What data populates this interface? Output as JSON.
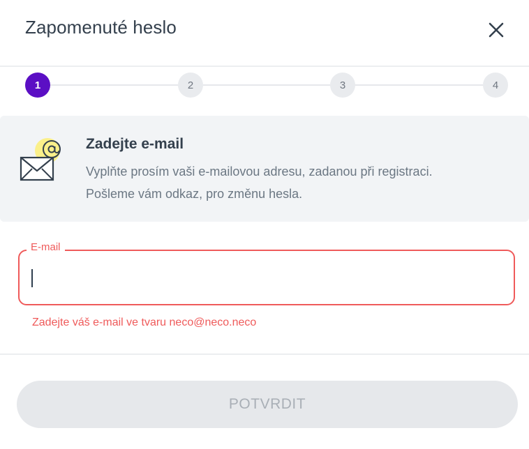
{
  "dialog": {
    "title": "Zapomenuté heslo",
    "close_icon": "close-icon"
  },
  "stepper": {
    "steps": [
      {
        "label": "1",
        "active": true
      },
      {
        "label": "2",
        "active": false
      },
      {
        "label": "3",
        "active": false
      },
      {
        "label": "4",
        "active": false
      }
    ]
  },
  "info": {
    "icon": "email-envelope-icon",
    "title": "Zadejte e-mail",
    "text_line1": "Vyplňte prosím vaši e-mailovou adresu, zadanou při registraci.",
    "text_line2": "Pošleme vám odkaz, pro změnu hesla."
  },
  "email_field": {
    "label": "E-mail",
    "value": "",
    "error": "Zadejte váš e-mail ve tvaru neco@neco.neco"
  },
  "submit": {
    "label": "POTVRDIT",
    "enabled": false
  },
  "colors": {
    "accent": "#5b0fc4",
    "error": "#ef5a5a",
    "disabled": "#e6e8eb"
  }
}
